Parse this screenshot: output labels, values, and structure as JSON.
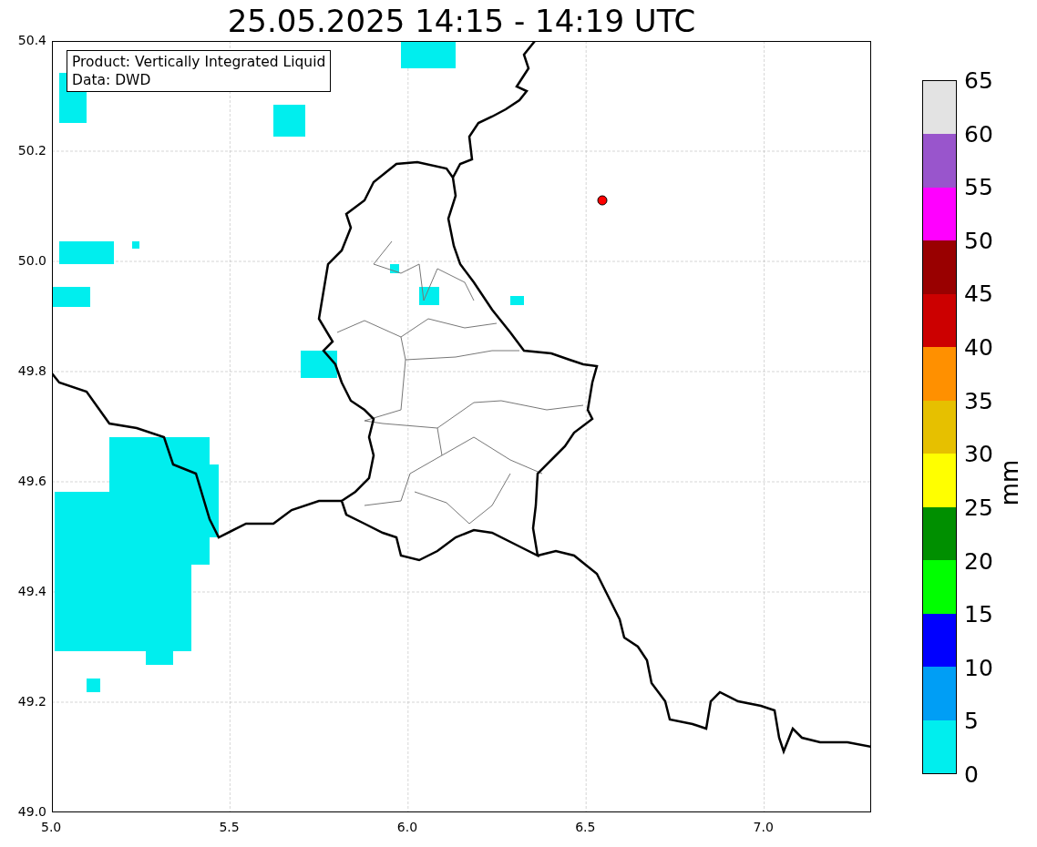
{
  "title": "25.05.2025 14:15 - 14:19 UTC",
  "info_box": [
    "Product: Vertically Integrated Liquid",
    "Data: DWD"
  ],
  "map": {
    "x_ticks": [
      "5.0",
      "5.5",
      "6.0",
      "6.5",
      "7.0"
    ],
    "y_ticks": [
      "50.4",
      "50.2",
      "50.0",
      "49.8",
      "49.6",
      "49.4",
      "49.2",
      "49.0"
    ]
  },
  "colorbar": {
    "label": "mm",
    "bins": [
      {
        "color": "#e3e3e3"
      },
      {
        "color": "#9955cc"
      },
      {
        "color": "#ff00ff"
      },
      {
        "color": "#990000"
      },
      {
        "color": "#cc0000"
      },
      {
        "color": "#ff9000"
      },
      {
        "color": "#e6c000"
      },
      {
        "color": "#ffff00"
      },
      {
        "color": "#008f00"
      },
      {
        "color": "#00ff00"
      },
      {
        "color": "#0000ff"
      },
      {
        "color": "#009ef5"
      },
      {
        "color": "#00eeee"
      }
    ],
    "ticks": [
      "65",
      "60",
      "55",
      "50",
      "45",
      "40",
      "35",
      "30",
      "25",
      "20",
      "15",
      "10",
      "5",
      "0"
    ]
  }
}
